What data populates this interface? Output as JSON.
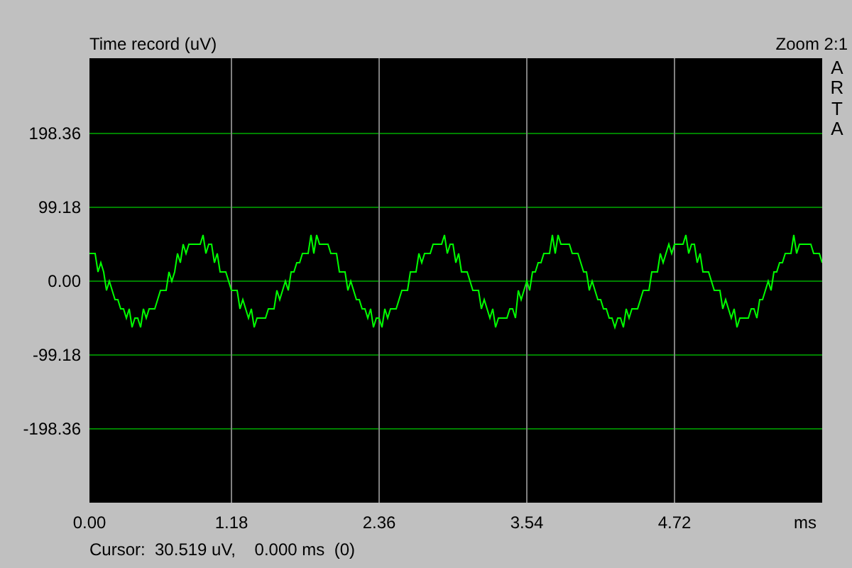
{
  "title": "Time record (uV)",
  "zoom": "Zoom 2:1",
  "brand": "ARTA",
  "y_ticks": [
    "198.36",
    "99.18",
    "0.00",
    "-99.18",
    "-198.36"
  ],
  "x_ticks": [
    "0.00",
    "1.18",
    "2.36",
    "3.54",
    "4.72"
  ],
  "x_unit": "ms",
  "cursor": "Cursor:  30.519 uV,    0.000 ms  (0)"
}
